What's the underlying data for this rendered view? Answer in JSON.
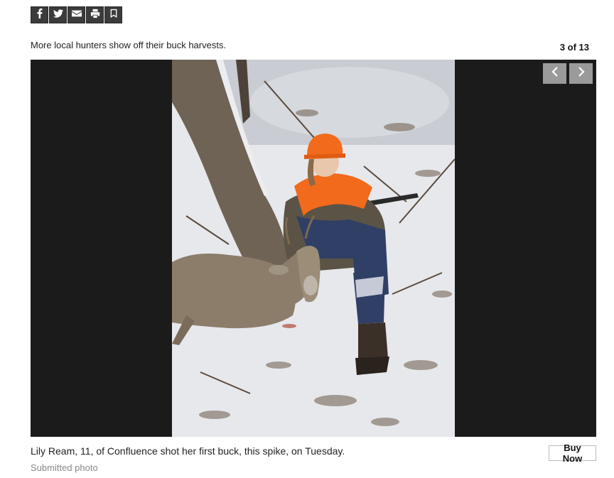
{
  "share": {
    "buttons": [
      {
        "icon": "facebook-icon"
      },
      {
        "icon": "twitter-icon"
      },
      {
        "icon": "email-icon"
      },
      {
        "icon": "print-icon"
      },
      {
        "icon": "bookmark-icon"
      }
    ]
  },
  "gallery": {
    "title": "More local hunters show off their buck harvests.",
    "counter": "3 of 13",
    "nav": {
      "prev_icon": "chevron-left-icon",
      "next_icon": "chevron-right-icon"
    }
  },
  "photo": {
    "caption": "Lily Ream, 11, of Confluence shot her first buck, this spike, on Tuesday.",
    "credit": "Submitted photo",
    "buy_label": "Buy Now"
  },
  "colors": {
    "share_bg": "#3b3b3b",
    "stage_bg": "#1b1b1b",
    "nav_bg": "#9a9a9a"
  }
}
